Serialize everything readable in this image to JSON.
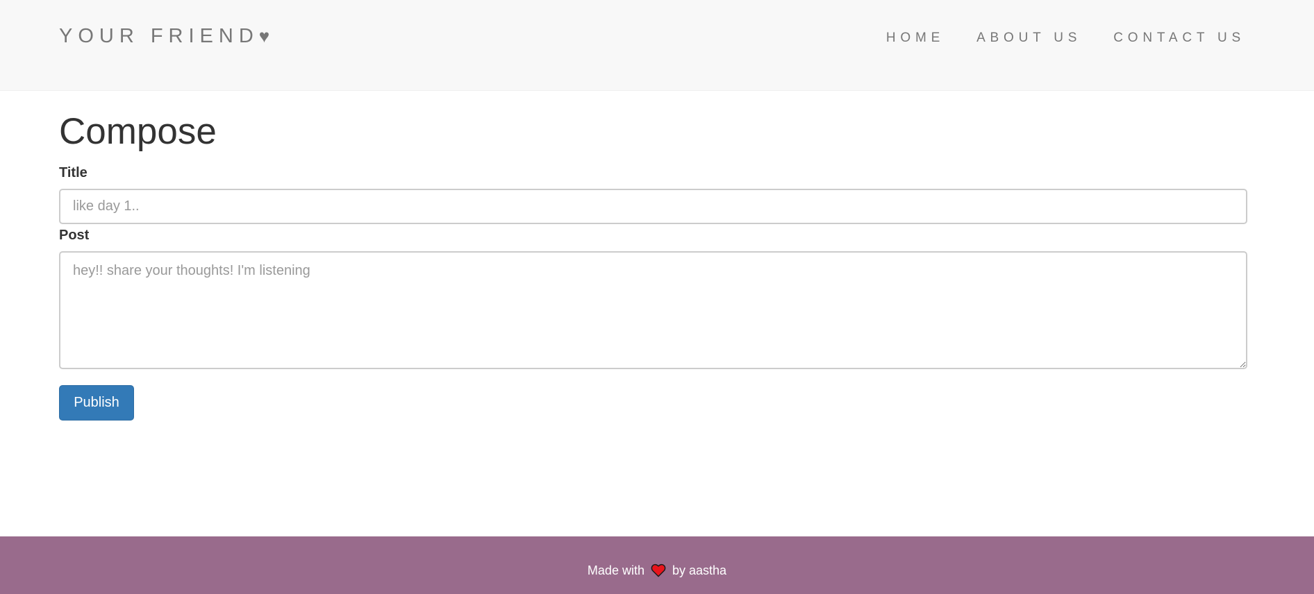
{
  "header": {
    "brand_text": "YOUR FRIEND",
    "brand_heart": "♥",
    "nav": {
      "home": "HOME",
      "about": "ABOUT US",
      "contact": "CONTACT US"
    }
  },
  "compose": {
    "heading": "Compose",
    "title_label": "Title",
    "title_placeholder": "like day 1..",
    "title_value": "",
    "post_label": "Post",
    "post_placeholder": "hey!! share your thoughts! I'm listening",
    "post_value": "",
    "publish_label": "Publish"
  },
  "footer": {
    "prefix": "Made with",
    "heart_icon": "heart-icon",
    "suffix": "by aastha"
  },
  "colors": {
    "navbar_bg": "#f8f8f8",
    "nav_text": "#777777",
    "button_primary": "#337ab7",
    "footer_bg": "#996b8c",
    "heart_red": "#e8141c"
  }
}
